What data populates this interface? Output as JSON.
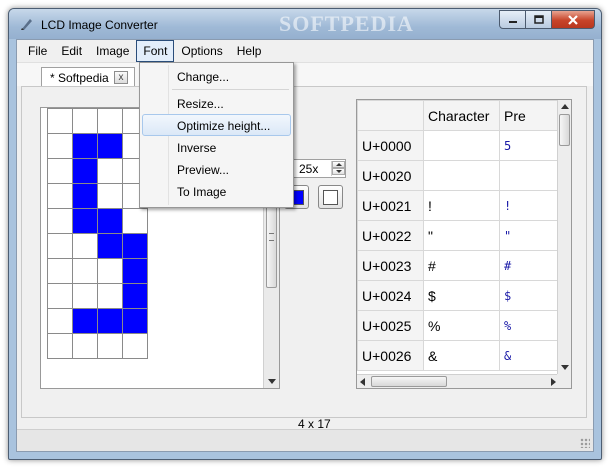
{
  "window": {
    "title": "LCD Image Converter",
    "watermark": "SOFTPEDIA"
  },
  "menu": {
    "items": [
      "File",
      "Edit",
      "Image",
      "Font",
      "Options",
      "Help"
    ],
    "open": "Font"
  },
  "font_menu": {
    "items": [
      "Change...",
      "Resize...",
      "Optimize height...",
      "Inverse",
      "Preview...",
      "To Image"
    ],
    "highlighted": "Optimize height..."
  },
  "tab": {
    "label": "* Softpedia",
    "close": "x"
  },
  "editor": {
    "zoom": "25x",
    "size_label": "4 x 17",
    "grid": {
      "cols": 4,
      "rows": 10,
      "on_color": "#0000ff",
      "off_color": "#ffffff",
      "line_color": "#8a8a8a",
      "pixels": [
        [
          0,
          0,
          0,
          0
        ],
        [
          0,
          1,
          1,
          0
        ],
        [
          0,
          1,
          0,
          0
        ],
        [
          0,
          1,
          0,
          0
        ],
        [
          0,
          1,
          1,
          0
        ],
        [
          0,
          0,
          1,
          1
        ],
        [
          0,
          0,
          0,
          1
        ],
        [
          0,
          0,
          0,
          1
        ],
        [
          0,
          1,
          1,
          1
        ],
        [
          0,
          0,
          0,
          0
        ]
      ]
    },
    "foreground_color": "#0000ff",
    "background_color": "#ffffff"
  },
  "char_table": {
    "columns": [
      "",
      "Character",
      "Pre"
    ],
    "rows": [
      {
        "code": "U+0000",
        "char": "",
        "preview": "5"
      },
      {
        "code": "U+0020",
        "char": "",
        "preview": ""
      },
      {
        "code": "U+0021",
        "char": "!",
        "preview": "!"
      },
      {
        "code": "U+0022",
        "char": "\"",
        "preview": "\""
      },
      {
        "code": "U+0023",
        "char": "#",
        "preview": "#"
      },
      {
        "code": "U+0024",
        "char": "$",
        "preview": "$"
      },
      {
        "code": "U+0025",
        "char": "%",
        "preview": "%"
      },
      {
        "code": "U+0026",
        "char": "&",
        "preview": "&"
      }
    ]
  }
}
